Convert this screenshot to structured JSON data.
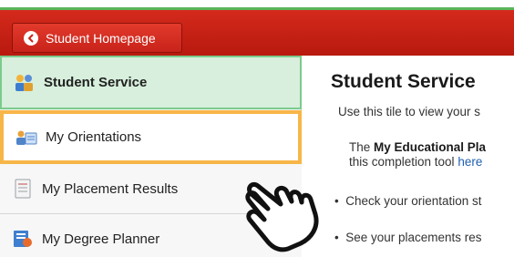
{
  "header": {
    "home_button_label": "Student Homepage",
    "brand_color": "#c8231a"
  },
  "sidebar": {
    "items": [
      {
        "label": "Student Service",
        "icon": "student-service-icon",
        "state": "active"
      },
      {
        "label": "My Orientations",
        "icon": "orientations-icon",
        "state": "highlighted"
      },
      {
        "label": "My Placement Results",
        "icon": "placement-results-icon",
        "state": "normal"
      },
      {
        "label": "My Degree Planner",
        "icon": "degree-planner-icon",
        "state": "normal"
      }
    ]
  },
  "main": {
    "title": "Student Service",
    "intro": "Use this tile to view your s",
    "para": {
      "prefix": "The ",
      "bold": "My Educational Pla",
      "line2": "this completion tool ",
      "link": "here"
    },
    "bullets": [
      "Check your orientation st",
      "See your placements res"
    ]
  },
  "colors": {
    "active_bg": "#d7efdc",
    "highlight_border": "#f7b648",
    "link": "#1f5fae"
  },
  "cursor": "pointing-hand-icon"
}
